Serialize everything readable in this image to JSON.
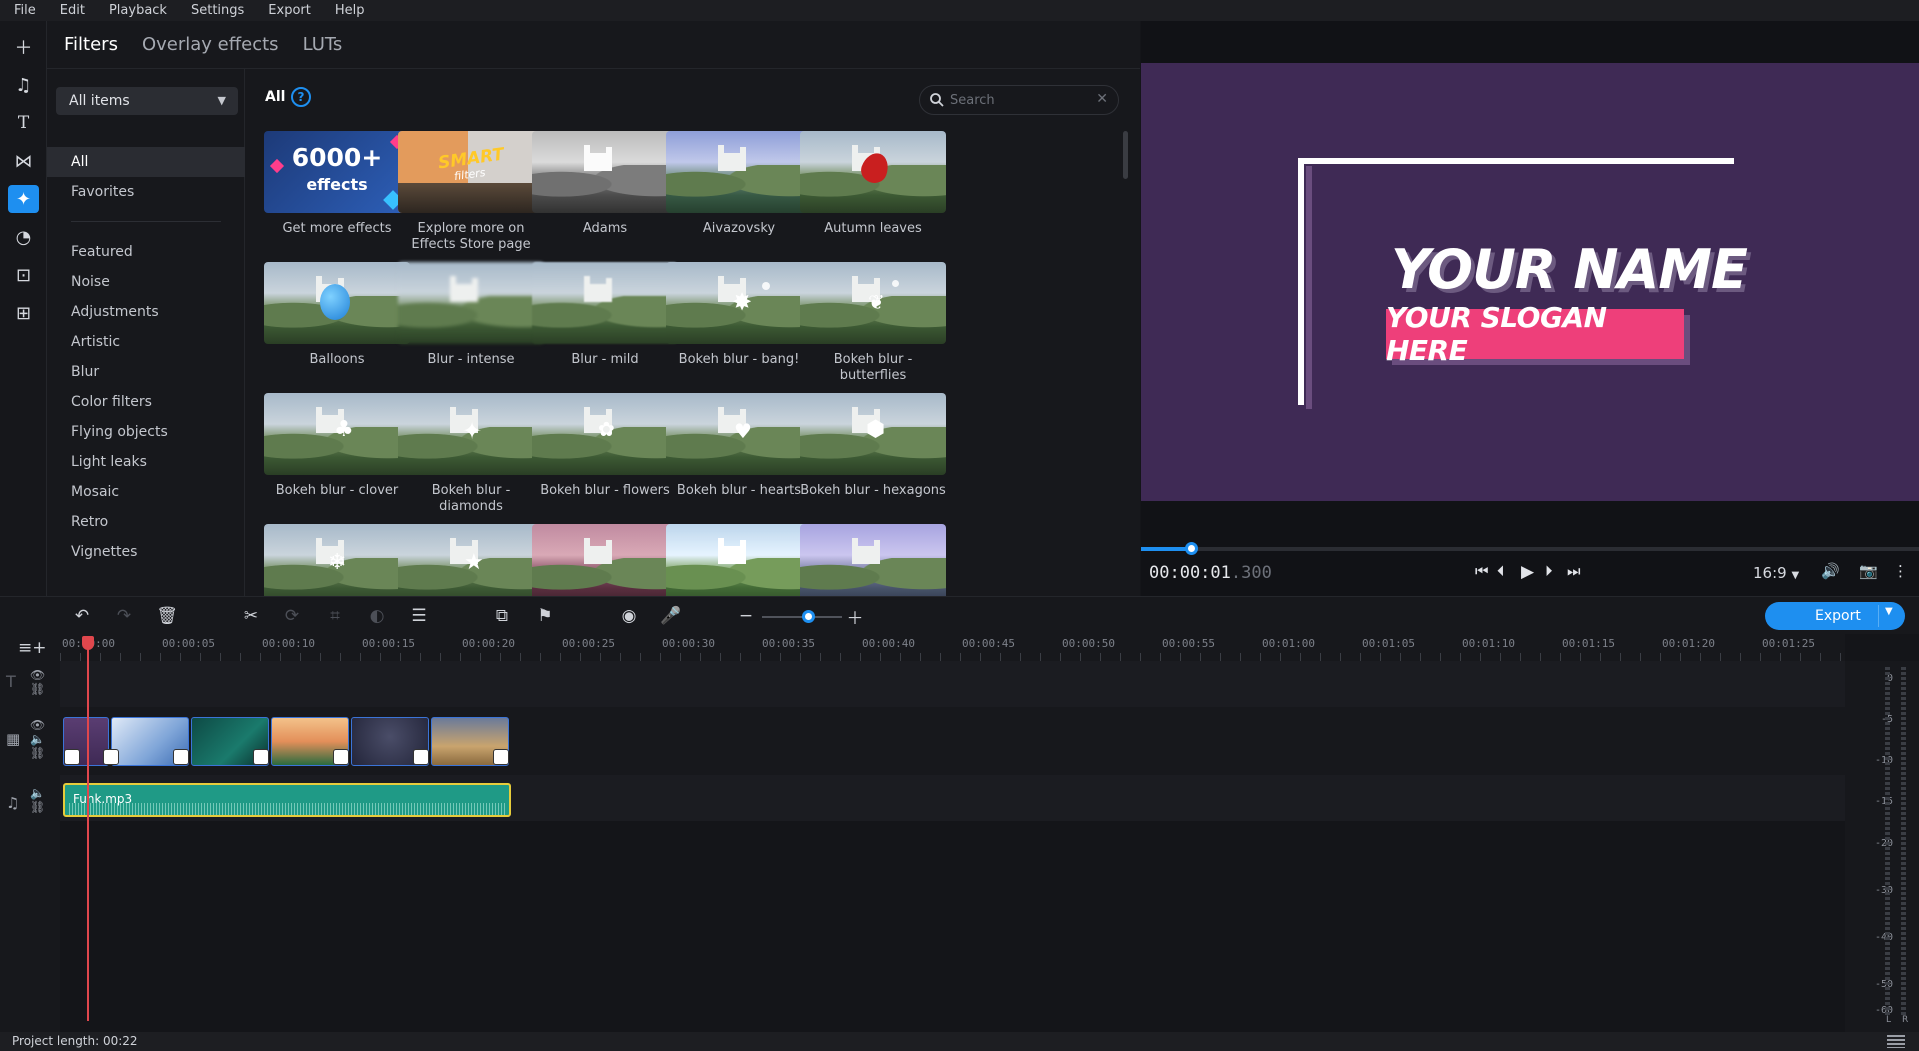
{
  "menu": [
    "File",
    "Edit",
    "Playback",
    "Settings",
    "Export",
    "Help"
  ],
  "panel_tabs": [
    "Filters",
    "Overlay effects",
    "LUTs"
  ],
  "category_select": "All items",
  "categories": [
    "All",
    "Favorites",
    "Featured",
    "Noise",
    "Adjustments",
    "Artistic",
    "Blur",
    "Color filters",
    "Flying objects",
    "Light leaks",
    "Mosaic",
    "Retro",
    "Vignettes"
  ],
  "grid": {
    "title": "All",
    "help": "?",
    "search_placeholder": "Search"
  },
  "promo": {
    "count": "6000+",
    "unit": "effects",
    "smart": "SMART",
    "filters": "filters"
  },
  "tiles": [
    {
      "label": "Get more effects"
    },
    {
      "label": "Explore more on Effects Store page"
    },
    {
      "label": "Adams"
    },
    {
      "label": "Aivazovsky"
    },
    {
      "label": "Autumn leaves"
    },
    {
      "label": "Balloons"
    },
    {
      "label": "Blur - intense"
    },
    {
      "label": "Blur - mild"
    },
    {
      "label": "Bokeh blur - bang!"
    },
    {
      "label": "Bokeh blur - butterflies"
    },
    {
      "label": "Bokeh blur - clover"
    },
    {
      "label": "Bokeh blur - diamonds"
    },
    {
      "label": "Bokeh blur - flowers"
    },
    {
      "label": "Bokeh blur - hearts"
    },
    {
      "label": "Bokeh blur - hexagons"
    }
  ],
  "preview": {
    "title_text": "YOUR NAME",
    "slogan_text": "YOUR SLOGAN HERE",
    "timecode_main": "00:00:01",
    "timecode_ms": ".300",
    "aspect_ratio": "16:9",
    "progress": 0.064
  },
  "toolbar": {
    "export_label": "Export"
  },
  "ruler_labels": [
    "00:00:00",
    "00:00:05",
    "00:00:10",
    "00:00:15",
    "00:00:20",
    "00:00:25",
    "00:00:30",
    "00:00:35",
    "00:00:40",
    "00:00:45",
    "00:00:50",
    "00:00:55",
    "00:01:00",
    "00:01:05",
    "00:01:10",
    "00:01:15",
    "00:01:20",
    "00:01:25"
  ],
  "audio_clip_name": "Funk.mp3",
  "meter_labels": [
    "0",
    "-5",
    "-10",
    "-15",
    "-20",
    "-30",
    "-40",
    "-50",
    "-60"
  ],
  "meter_channels": [
    "L",
    "R"
  ],
  "status": {
    "project_length": "Project length: 00:22"
  },
  "colors": {
    "accent": "#1e8ff0",
    "canvas_bg": "#3f2a55",
    "slogan_bg": "#ee3f7a",
    "audio_clip": "#1f9a86",
    "playhead": "#e0474d"
  }
}
